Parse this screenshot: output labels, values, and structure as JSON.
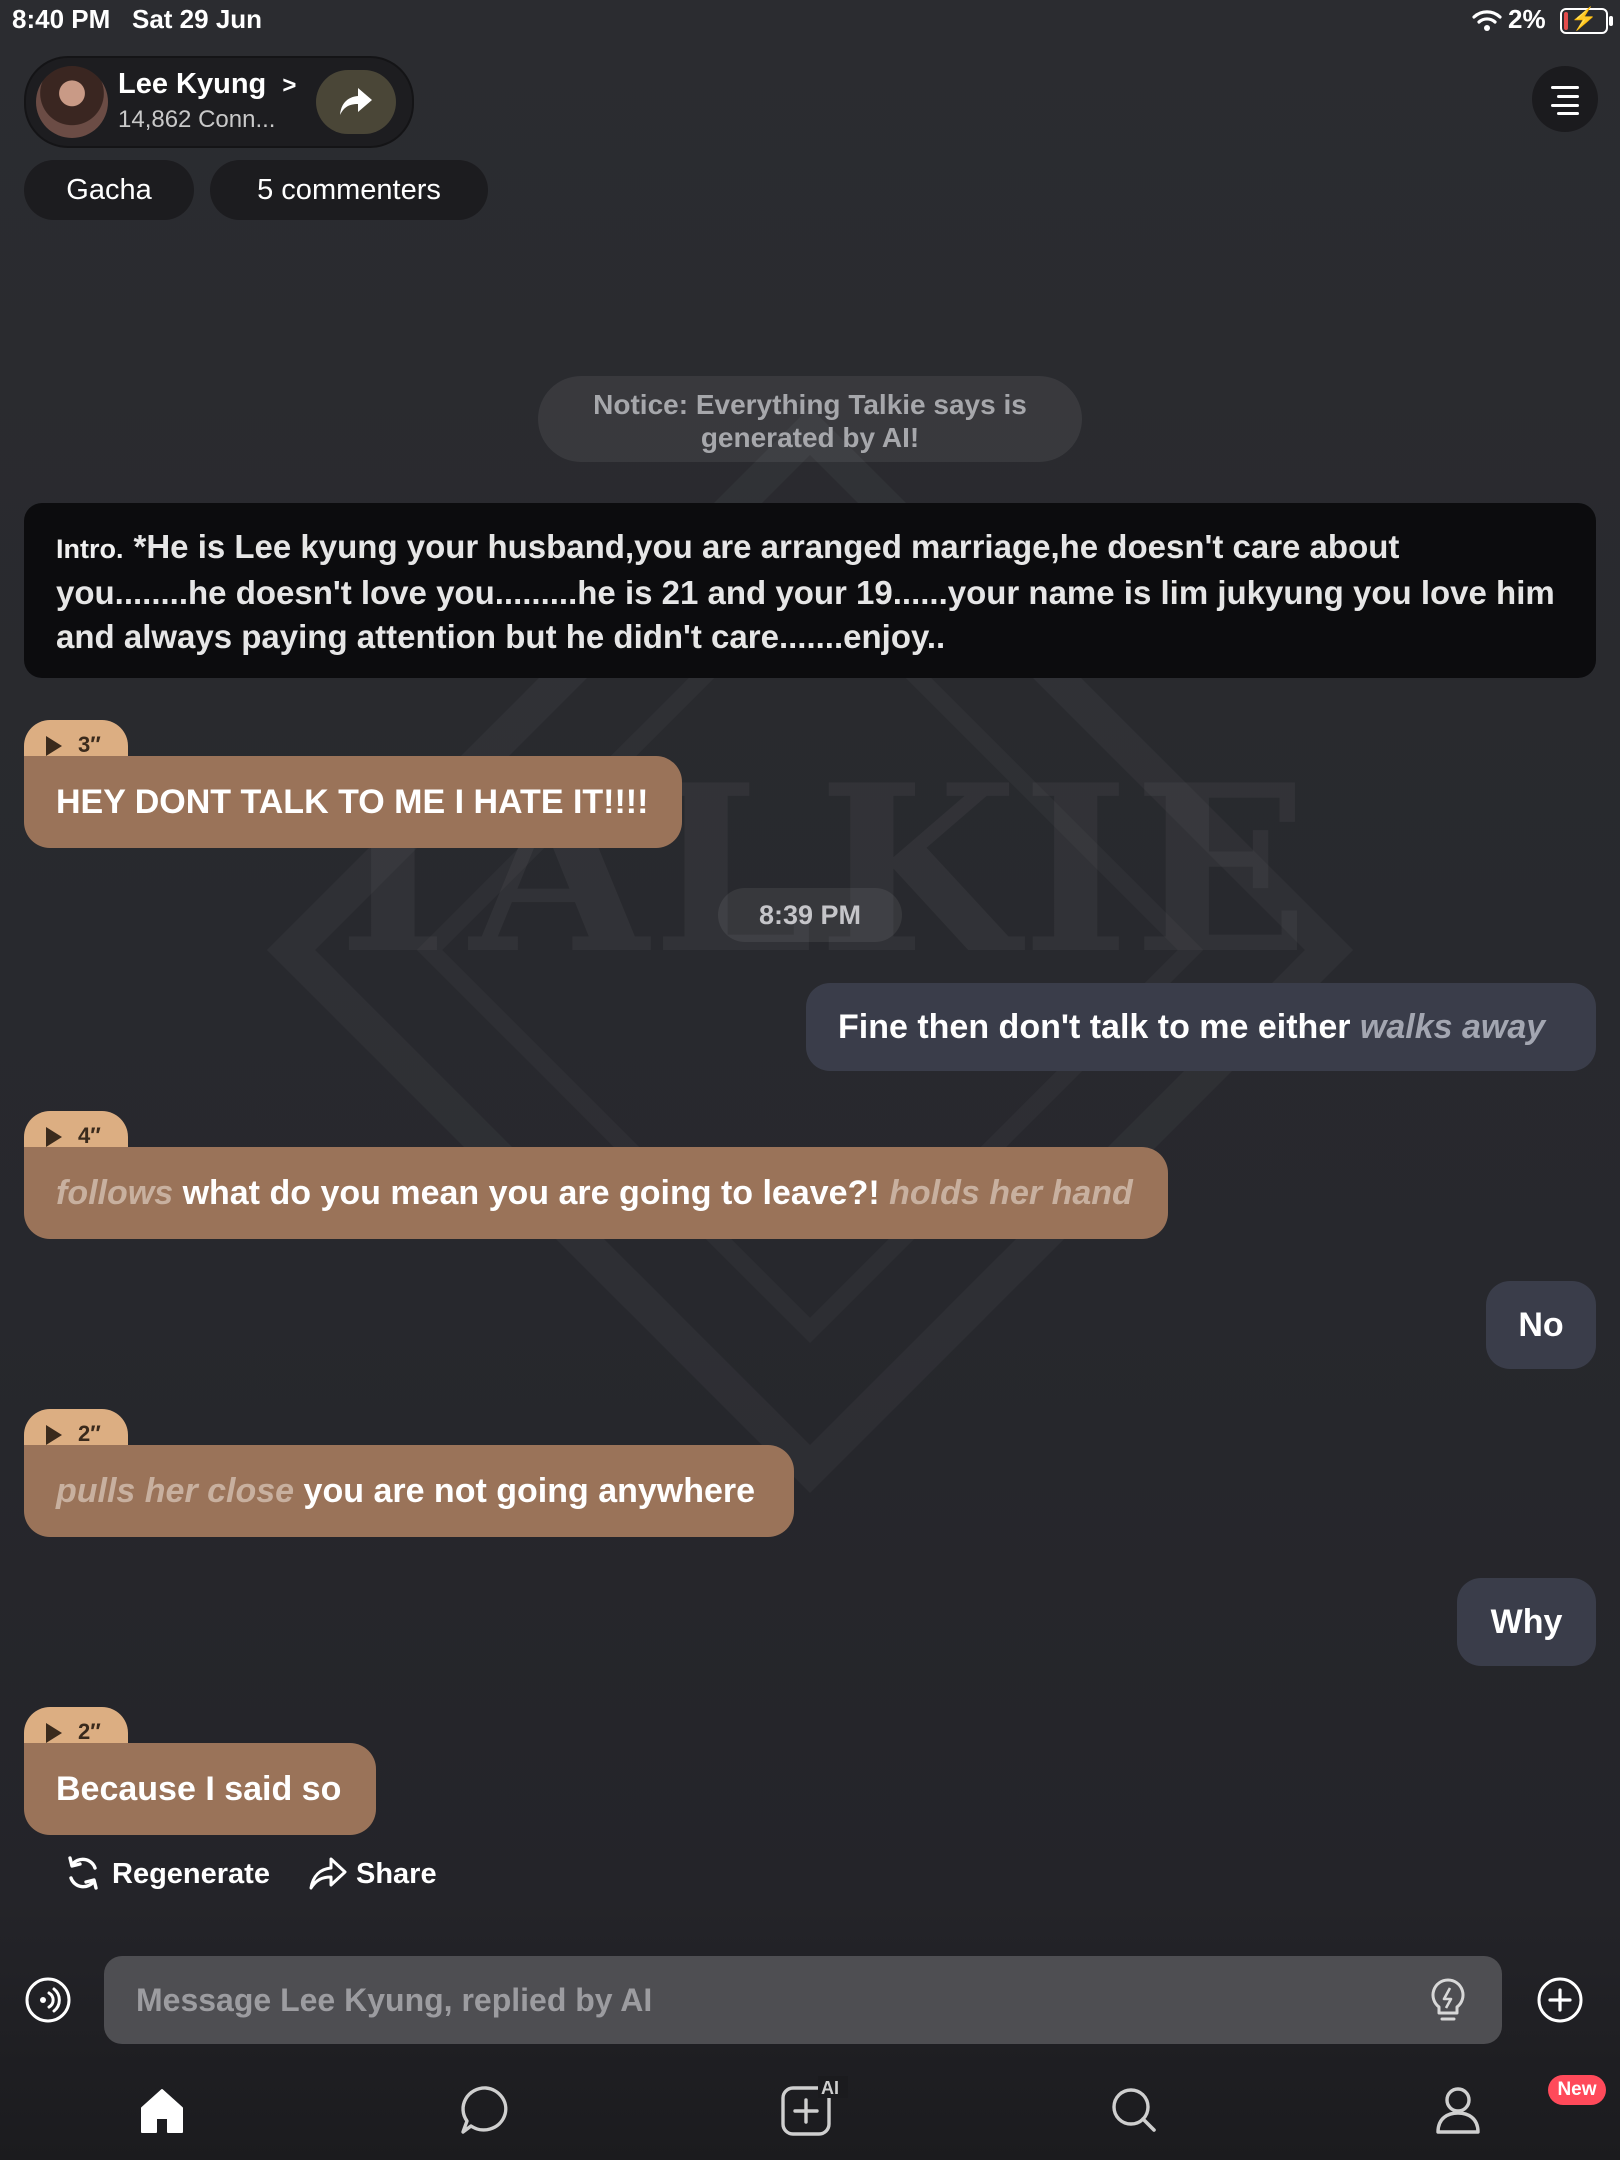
{
  "status_bar": {
    "time": "8:40 PM",
    "date": "Sat 29 Jun",
    "battery": "2%",
    "battery_level": 0.02
  },
  "header": {
    "name": "Lee Kyung",
    "name_chevron": ">",
    "connections": "14,862 Conn...",
    "tags": [
      "Gacha",
      "5 commenters"
    ]
  },
  "watermark": "TALKIE",
  "notice": {
    "line1": "Notice: Everything Talkie says is",
    "line2": "generated by AI!"
  },
  "intro": {
    "label": "Intro.",
    "text": "*He is Lee kyung your husband,you are arranged marriage,he doesn't care about you........he doesn't love you.........he is 21 and your 19......your name is lim jukyung you love him and always paying attention but he didn't care.......enjoy.."
  },
  "messages": {
    "m1": {
      "duration": "3″",
      "text": "HEY DONT TALK TO ME I HATE IT!!!!"
    },
    "time_divider": "8:39 PM",
    "m2": {
      "text": "Fine then don't talk to me either",
      "action": "walks away"
    },
    "m3": {
      "duration": "4″",
      "action_before": "follows",
      "text": "what do you mean you are going to leave?!",
      "action_after": "holds her hand"
    },
    "m4": {
      "text": "No"
    },
    "m5": {
      "duration": "2″",
      "action_before": "pulls her close",
      "text": "you are not going anywhere"
    },
    "m6": {
      "text": "Why"
    },
    "m7": {
      "duration": "2″",
      "text": "Because I said so"
    }
  },
  "actions": {
    "regenerate": "Regenerate",
    "share": "Share"
  },
  "composer": {
    "placeholder": "Message Lee Kyung, replied by AI",
    "value": ""
  },
  "tabbar": {
    "create_badge": "AI",
    "new_badge": "New"
  },
  "colors": {
    "ai_bubble": "#9a7359",
    "duration_tag": "#dcae82",
    "user_bubble": "#3a3d4a",
    "new_badge": "#ff4a5a"
  }
}
